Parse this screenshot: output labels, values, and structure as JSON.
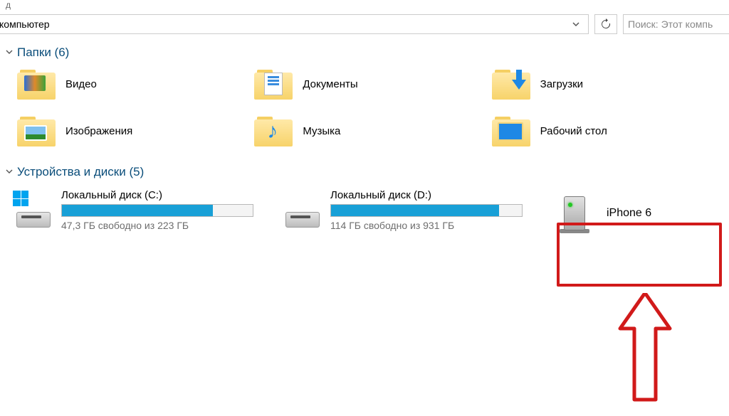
{
  "header_fragment": "д",
  "address": "компьютер",
  "search_placeholder": "Поиск: Этот компь",
  "sections": {
    "folders": {
      "title": "Папки",
      "count": 6
    },
    "drives": {
      "title": "Устройства и диски",
      "count": 5
    }
  },
  "folders": [
    {
      "label": "Видео"
    },
    {
      "label": "Документы"
    },
    {
      "label": "Загрузки"
    },
    {
      "label": "Изображения"
    },
    {
      "label": "Музыка"
    },
    {
      "label": "Рабочий стол"
    }
  ],
  "drives": [
    {
      "name": "Локальный диск (C:)",
      "free_text": "47,3 ГБ свободно из 223 ГБ",
      "fill_pct": 79
    },
    {
      "name": "Локальный диск (D:)",
      "free_text": "114 ГБ свободно из 931 ГБ",
      "fill_pct": 88
    }
  ],
  "device": {
    "label": "iPhone 6"
  }
}
